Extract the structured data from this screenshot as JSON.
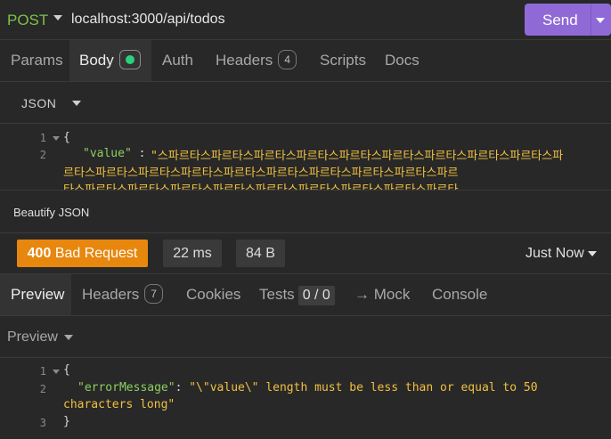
{
  "request": {
    "method": "POST",
    "url": "localhost:3000/api/todos",
    "send_label": "Send"
  },
  "request_tabs": {
    "params": "Params",
    "body": "Body",
    "auth": "Auth",
    "headers": "Headers",
    "headers_count": "4",
    "scripts": "Scripts",
    "docs": "Docs"
  },
  "body_type": "JSON",
  "request_body": {
    "line_numbers": [
      "1",
      "2"
    ],
    "open_brace": "{",
    "key": "\"value\"",
    "colon": " : ",
    "value_line1": "\"스파르타스파르타스파르타스파르타스파르타스파르타스파르타스파르타스파르타스파",
    "value_line2": "르타스파르타스파르타스파르타스파르타스파르타스파르타스파르타스파르타스파르",
    "value_line3": "타스파르타스파르타스파르타스파르타스파르타스파르타스파르타스파르타스파르타"
  },
  "beautify_label": "Beautify JSON",
  "response_status": {
    "code": "400",
    "text": "Bad Request",
    "time": "22 ms",
    "size": "84 B",
    "when": "Just Now",
    "status_color": "#e8870e"
  },
  "response_tabs": {
    "preview": "Preview",
    "headers": "Headers",
    "headers_count": "7",
    "cookies": "Cookies",
    "tests": "Tests",
    "tests_count": "0 / 0",
    "mock": "→ Mock",
    "console": "Console"
  },
  "preview_mode": "Preview",
  "response_body": {
    "line_numbers": [
      "1",
      "2",
      "3"
    ],
    "open_brace": "{",
    "key": "\"errorMessage\"",
    "colon": ": ",
    "value_line1": "\"\\\"value\\\" length must be less than or equal to 50",
    "value_line2": "characters long\"",
    "close_brace": "}"
  },
  "colors": {
    "accent": "#8f6ad6",
    "method": "#7ec24a",
    "json_key": "#8cd060",
    "json_string": "#f0c040",
    "indicator_dot": "#2bd17a"
  }
}
